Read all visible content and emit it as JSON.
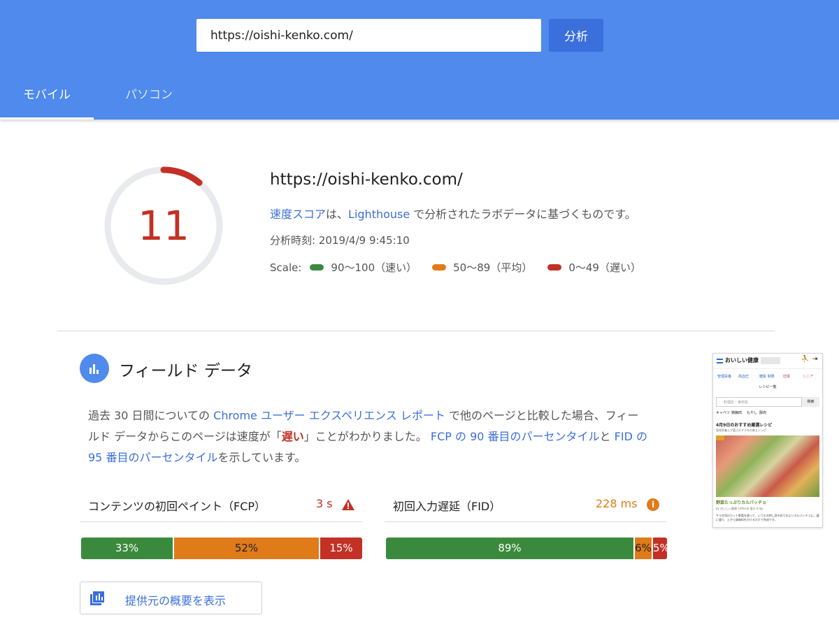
{
  "search": {
    "url_value": "https://oishi-kenko.com/",
    "analyze_label": "分析"
  },
  "tabs": [
    {
      "label": "モバイル",
      "active": true
    },
    {
      "label": "パソコン",
      "active": false
    }
  ],
  "summary": {
    "score": "11",
    "score_fraction": 0.11,
    "score_color": "#c33025",
    "url": "https://oishi-kenko.com/",
    "desc_link1": "速度スコア",
    "desc_mid": "は、",
    "desc_link2": "Lighthouse",
    "desc_tail": " で分析されたラボデータに基づくものです。",
    "analysis_time": "分析時刻: 2019/4/9 9:45:10",
    "scale_label": "Scale:",
    "scale": [
      {
        "label": "90〜100（速い）",
        "color": "#3a8a3e"
      },
      {
        "label": "50〜89（平均）",
        "color": "#e07b1a"
      },
      {
        "label": "0〜49（遅い）",
        "color": "#c33025"
      }
    ]
  },
  "field": {
    "title": "フィールド データ",
    "icon": "bar-chart-icon",
    "desc": {
      "p1": "過去 30 日間についての ",
      "link1": "Chrome ユーザー エクスペリエンス レポート",
      "p2": " で他のページと比較した場合、フィールド データからこのページは速度が「",
      "slow_word": "遅い",
      "p3": "」ことがわかりました。 ",
      "link2": "FCP の 90 番目のパーセンタイル",
      "p4": "と ",
      "link3": "FID の 95 番目のパーセンタイル",
      "p5": "を示しています。"
    },
    "fcp": {
      "label": "コンテンツの初回ペイント（FCP）",
      "value": "3 s",
      "value_color": "#c33025",
      "status_icon": "warning-icon",
      "distribution": [
        {
          "label": "33%",
          "fraction": 0.33,
          "class": "fast"
        },
        {
          "label": "52%",
          "fraction": 0.52,
          "class": "avg"
        },
        {
          "label": "15%",
          "fraction": 0.15,
          "class": "slow"
        }
      ]
    },
    "fid": {
      "label": "初回入力遅延（FID）",
      "value": "228 ms",
      "value_color": "#e07b1a",
      "status_icon": "info-icon",
      "distribution": [
        {
          "label": "89%",
          "fraction": 0.89,
          "class": "fast"
        },
        {
          "label": "6%",
          "fraction": 0.06,
          "class": "avg"
        },
        {
          "label": "5%",
          "fraction": 0.05,
          "class": "slow"
        }
      ]
    },
    "origin_button": "提供元の概要を表示",
    "origin_icon": "library-icon"
  },
  "preview": {
    "logo": "おいしい健康",
    "nav": [
      "管理栄養",
      "高血圧",
      "糖質\n制限",
      "妊娠",
      "シニア"
    ],
    "sub": "レシピ一覧",
    "search_placeholder": "料理名・食材名",
    "search_button": "検索",
    "categories": [
      "キャベツ",
      "鶏胸肉",
      "もやし",
      "豚肉"
    ],
    "heading": "4月9日のおすすめ厳選レシピ",
    "subheading": "管理栄養士が選ぶおすすめの献立レシピ",
    "recipe": "野菜たっぷりカルパッチョ",
    "meta": "by おいしい健康   140kcal   塩分 0.4g",
    "text": "サラダ用のカット野菜を使って、いつもの刺し身を彩りのよいカルパッチョに。器に盛り、上から調味料をかけるだけで完成です。"
  }
}
